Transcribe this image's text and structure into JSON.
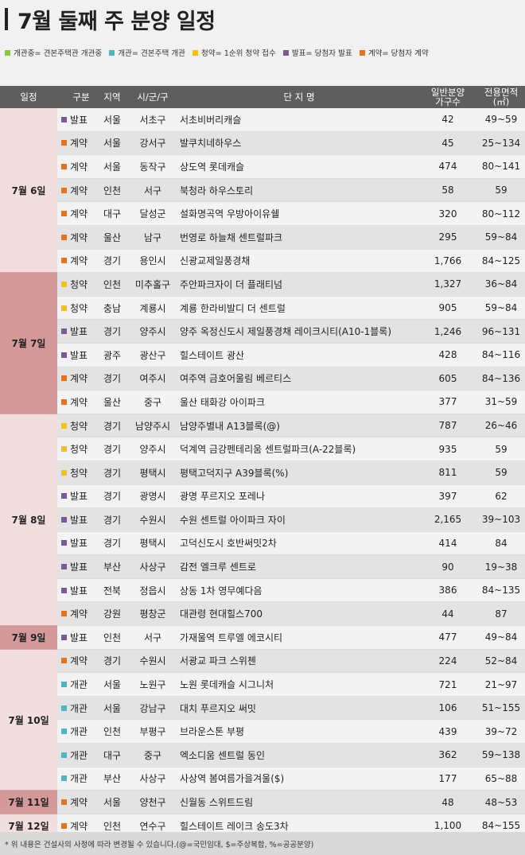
{
  "title": "7월 둘째 주 분양 일정",
  "colors": {
    "model_house": "#8cc63f",
    "open": "#4bb8c0",
    "subscription": "#f5c400",
    "announce": "#7b5a96",
    "contract": "#e8711c",
    "header_bg": "#5e5e5e",
    "date_light": "#f2dede",
    "date_dark": "#d49a9a"
  },
  "legend": [
    {
      "key": "model_house",
      "label": "개관중= 견본주택관 개관중"
    },
    {
      "key": "open",
      "label": "개관= 견본주택 개관"
    },
    {
      "key": "subscription",
      "label": "청약= 1순위 청약 접수"
    },
    {
      "key": "announce",
      "label": "발표= 당첨자 발표"
    },
    {
      "key": "contract",
      "label": "계약= 당첨자 계약"
    }
  ],
  "columns": {
    "date": "일정",
    "type": "구분",
    "region": "지역",
    "city": "시/군/구",
    "name": "단 지 명",
    "units_1": "일반분양",
    "units_2": "가구수",
    "area_1": "전용면적",
    "area_2": "(㎡)"
  },
  "date_groups": [
    {
      "label": "7월 6일",
      "rows": 7,
      "shade": "light"
    },
    {
      "label": "7월 7일",
      "rows": 6,
      "shade": "dark"
    },
    {
      "label": "7월 8일",
      "rows": 9,
      "shade": "light"
    },
    {
      "label": "7월 9일",
      "rows": 1,
      "shade": "dark"
    },
    {
      "label": "7월 10일",
      "rows": 6,
      "shade": "light"
    },
    {
      "label": "7월 11일",
      "rows": 1,
      "shade": "dark"
    },
    {
      "label": "7월 12일",
      "rows": 1,
      "shade": "light"
    }
  ],
  "rows": [
    {
      "type": "발표",
      "kind": "announce",
      "region": "서울",
      "city": "서초구",
      "name": "서초비버리캐슬",
      "units": "42",
      "area": "49~59"
    },
    {
      "type": "계약",
      "kind": "contract",
      "region": "서울",
      "city": "강서구",
      "name": "발쿠치네하우스",
      "units": "45",
      "area": "25~134"
    },
    {
      "type": "계약",
      "kind": "contract",
      "region": "서울",
      "city": "동작구",
      "name": "상도역 롯데캐슬",
      "units": "474",
      "area": "80~141"
    },
    {
      "type": "계약",
      "kind": "contract",
      "region": "인천",
      "city": "서구",
      "name": "북청라 하우스토리",
      "units": "58",
      "area": "59"
    },
    {
      "type": "계약",
      "kind": "contract",
      "region": "대구",
      "city": "달성군",
      "name": "설화명곡역 우방아이유쉘",
      "units": "320",
      "area": "80~112"
    },
    {
      "type": "계약",
      "kind": "contract",
      "region": "울산",
      "city": "남구",
      "name": "번영로 하늘채 센트럴파크",
      "units": "295",
      "area": "59~84"
    },
    {
      "type": "계약",
      "kind": "contract",
      "region": "경기",
      "city": "용인시",
      "name": "신광교제일풍경채",
      "units": "1,766",
      "area": "84~125"
    },
    {
      "type": "청약",
      "kind": "subscription",
      "region": "인천",
      "city": "미추홀구",
      "name": "주안파크자이 더 플래티넘",
      "units": "1,327",
      "area": "36~84"
    },
    {
      "type": "청약",
      "kind": "subscription",
      "region": "충남",
      "city": "계룡시",
      "name": "계룡 한라비발디 더 센트럴",
      "units": "905",
      "area": "59~84"
    },
    {
      "type": "발표",
      "kind": "announce",
      "region": "경기",
      "city": "양주시",
      "name": "양주 옥정신도시 제일풍경채 레이크시티(A10-1블록)",
      "units": "1,246",
      "area": "96~131"
    },
    {
      "type": "발표",
      "kind": "announce",
      "region": "광주",
      "city": "광산구",
      "name": "힐스테이트 광산",
      "units": "428",
      "area": "84~116"
    },
    {
      "type": "계약",
      "kind": "contract",
      "region": "경기",
      "city": "여주시",
      "name": "여주역 금호어울림 베르티스",
      "units": "605",
      "area": "84~136"
    },
    {
      "type": "계약",
      "kind": "contract",
      "region": "울산",
      "city": "중구",
      "name": "울산 태화강 아이파크",
      "units": "377",
      "area": "31~59"
    },
    {
      "type": "청약",
      "kind": "subscription",
      "region": "경기",
      "city": "남양주시",
      "name": "남양주별내 A13블록(@)",
      "units": "787",
      "area": "26~46"
    },
    {
      "type": "청약",
      "kind": "subscription",
      "region": "경기",
      "city": "양주시",
      "name": "덕계역 금강펜테리움 센트럴파크(A-22블록)",
      "units": "935",
      "area": "59"
    },
    {
      "type": "청약",
      "kind": "subscription",
      "region": "경기",
      "city": "평택시",
      "name": "평택고덕지구 A39블록(%)",
      "units": "811",
      "area": "59"
    },
    {
      "type": "발표",
      "kind": "announce",
      "region": "경기",
      "city": "광명시",
      "name": "광명 푸르지오 포레나",
      "units": "397",
      "area": "62"
    },
    {
      "type": "발표",
      "kind": "announce",
      "region": "경기",
      "city": "수원시",
      "name": "수원 센트럴 아이파크 자이",
      "units": "2,165",
      "area": "39~103"
    },
    {
      "type": "발표",
      "kind": "announce",
      "region": "경기",
      "city": "평택시",
      "name": "고덕신도시 호반써밋2차",
      "units": "414",
      "area": "84"
    },
    {
      "type": "발표",
      "kind": "announce",
      "region": "부산",
      "city": "사상구",
      "name": "감전 엘크루 센트로",
      "units": "90",
      "area": "19~38"
    },
    {
      "type": "발표",
      "kind": "announce",
      "region": "전북",
      "city": "정읍시",
      "name": "상동 1차 영무예다음",
      "units": "386",
      "area": "84~135"
    },
    {
      "type": "계약",
      "kind": "contract",
      "region": "강원",
      "city": "평창군",
      "name": "대관령 현대힐스700",
      "units": "44",
      "area": "87"
    },
    {
      "type": "발표",
      "kind": "announce",
      "region": "인천",
      "city": "서구",
      "name": "가재울역 트루엘 에코시티",
      "units": "477",
      "area": "49~84"
    },
    {
      "type": "계약",
      "kind": "contract",
      "region": "경기",
      "city": "수원시",
      "name": "서광교 파크 스위첸",
      "units": "224",
      "area": "52~84"
    },
    {
      "type": "개관",
      "kind": "open",
      "region": "서울",
      "city": "노원구",
      "name": "노원 롯데캐슬 시그니처",
      "units": "721",
      "area": "21~97"
    },
    {
      "type": "개관",
      "kind": "open",
      "region": "서울",
      "city": "강남구",
      "name": "대치 푸르지오 써밋",
      "units": "106",
      "area": "51~155"
    },
    {
      "type": "개관",
      "kind": "open",
      "region": "인천",
      "city": "부평구",
      "name": "브라운스톤 부평",
      "units": "439",
      "area": "39~72"
    },
    {
      "type": "개관",
      "kind": "open",
      "region": "대구",
      "city": "중구",
      "name": "엑소디움 센트럴 동인",
      "units": "362",
      "area": "59~138"
    },
    {
      "type": "개관",
      "kind": "open",
      "region": "부산",
      "city": "사상구",
      "name": "사상역 봄여름가을겨울($)",
      "units": "177",
      "area": "65~88"
    },
    {
      "type": "계약",
      "kind": "contract",
      "region": "서울",
      "city": "양천구",
      "name": "신월동 스위트드림",
      "units": "48",
      "area": "48~53"
    },
    {
      "type": "계약",
      "kind": "contract",
      "region": "인천",
      "city": "연수구",
      "name": "힐스테이트 레이크 송도3차",
      "units": "1,100",
      "area": "84~155"
    }
  ],
  "footnote": "* 위 내용은 건설사의 사정에 따라 변경될 수 있습니다.(@=국민임대, $=주상복합, %=공공분양)"
}
